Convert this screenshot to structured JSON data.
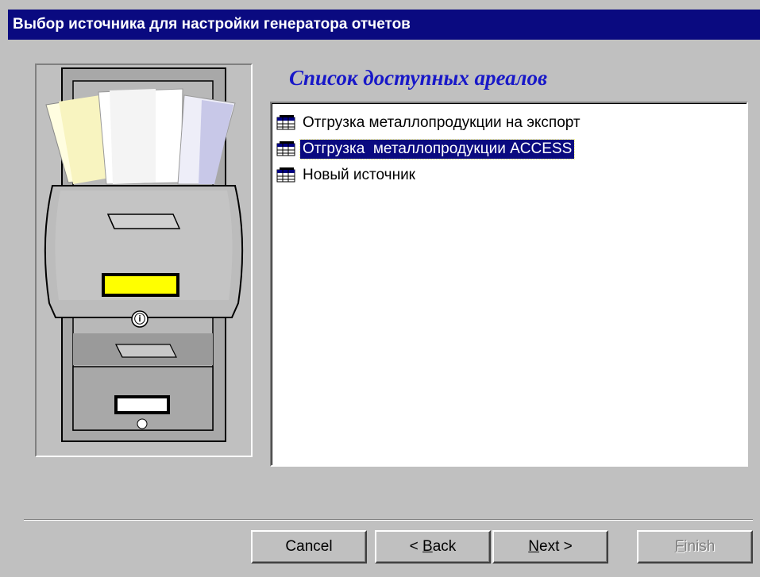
{
  "window": {
    "title": "Выбор источника для настройки генератора отчетов"
  },
  "list": {
    "heading": "Список доступных ареалов",
    "selected_index": 1,
    "items": [
      {
        "label": "Отгрузка металлопродукции на экспорт",
        "icon": "table-icon"
      },
      {
        "label": "Отгрузка  металлопродукции ACCESS",
        "icon": "table-icon"
      },
      {
        "label": "Новый источник",
        "icon": "table-icon"
      }
    ]
  },
  "buttons": {
    "cancel": {
      "label": "Cancel",
      "enabled": true
    },
    "back": {
      "prefix": "< ",
      "mnemonic": "B",
      "rest": "ack",
      "enabled": true
    },
    "next": {
      "prefix": "",
      "mnemonic": "N",
      "rest": "ext >",
      "enabled": true
    },
    "finish": {
      "prefix": "",
      "mnemonic": "F",
      "rest": "inish",
      "enabled": false
    }
  },
  "colors": {
    "titlebar": "#0a0a80",
    "heading": "#1818c8",
    "selection": "#0a0a80",
    "face": "#c0c0c0"
  }
}
